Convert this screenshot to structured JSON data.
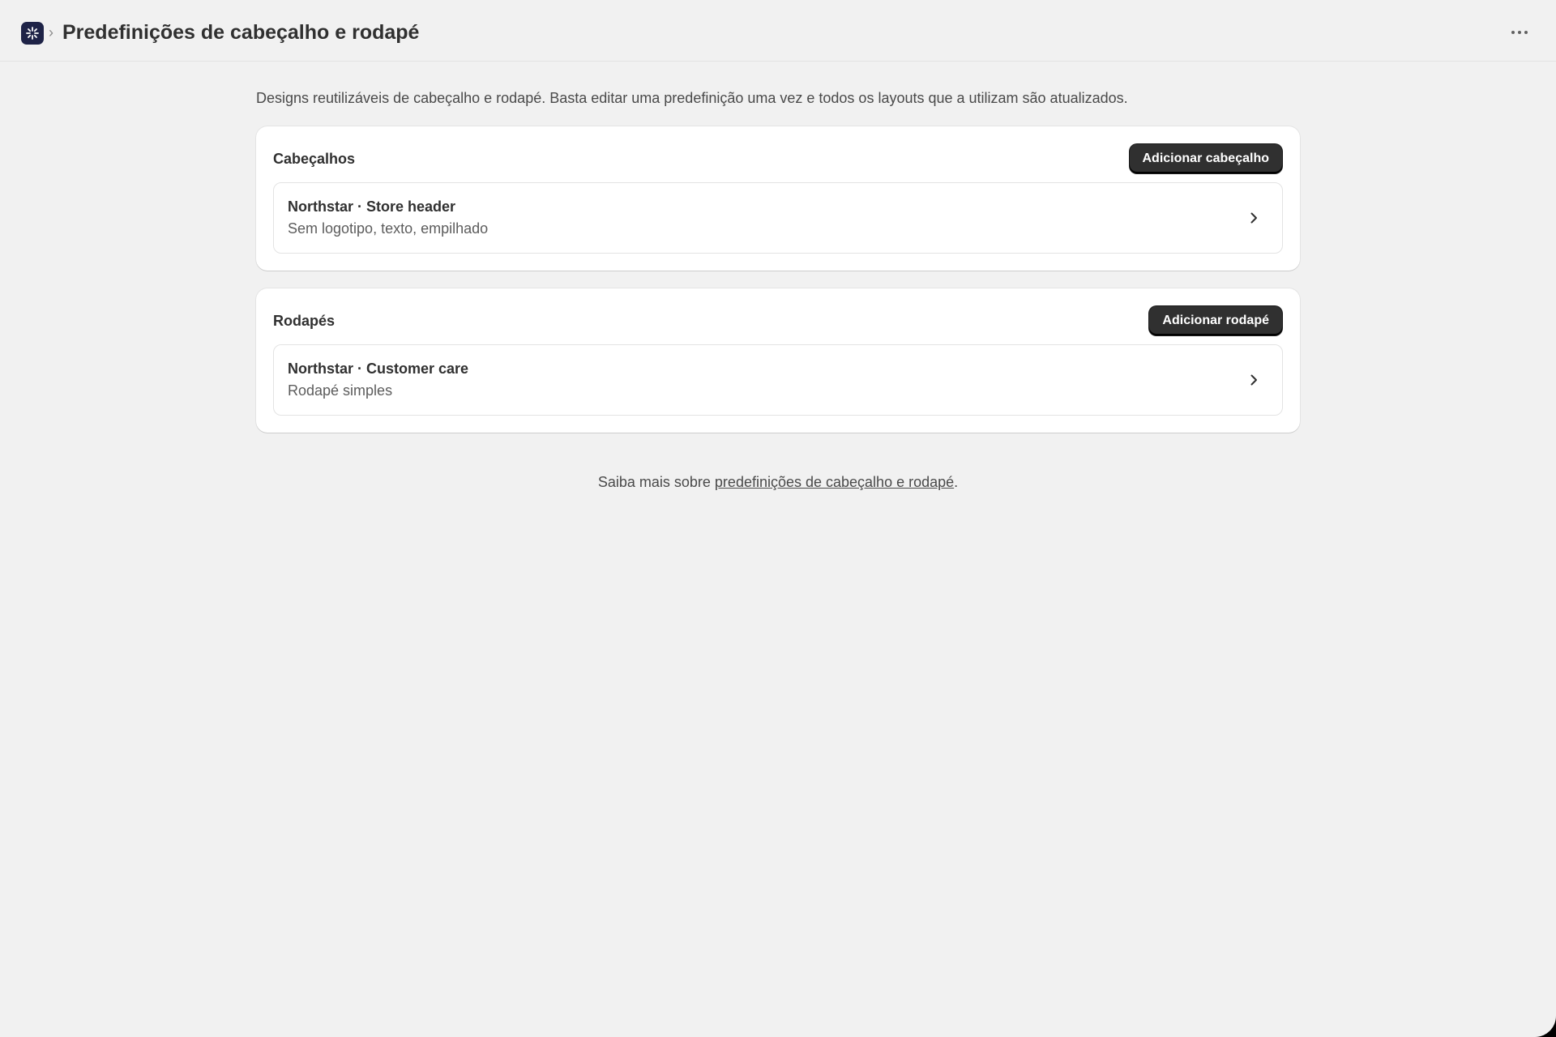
{
  "header": {
    "app_icon": "app-logo-icon",
    "breadcrumb_separator": "›",
    "title": "Predefinições de cabeçalho e rodapé",
    "more_icon": "more-horizontal-icon"
  },
  "main": {
    "description": "Designs reutilizáveis de cabeçalho e rodapé. Basta editar uma predefinição uma vez e todos os layouts que a utilizam são atualizados.",
    "headers_section": {
      "title": "Cabeçalhos",
      "add_button": "Adicionar cabeçalho",
      "items": [
        {
          "name": "Northstar · Store header",
          "description": "Sem logotipo, texto, empilhado"
        }
      ]
    },
    "footers_section": {
      "title": "Rodapés",
      "add_button": "Adicionar rodapé",
      "items": [
        {
          "name": "Northstar · Customer care",
          "description": "Rodapé simples"
        }
      ]
    },
    "learn_more": {
      "prefix": "Saiba mais sobre ",
      "link_text": "predefinições de cabeçalho e rodapé",
      "suffix": "."
    }
  },
  "colors": {
    "background": "#f1f1f1",
    "card": "#ffffff",
    "primary_button": "#303030",
    "app_icon": "#1e2347"
  }
}
